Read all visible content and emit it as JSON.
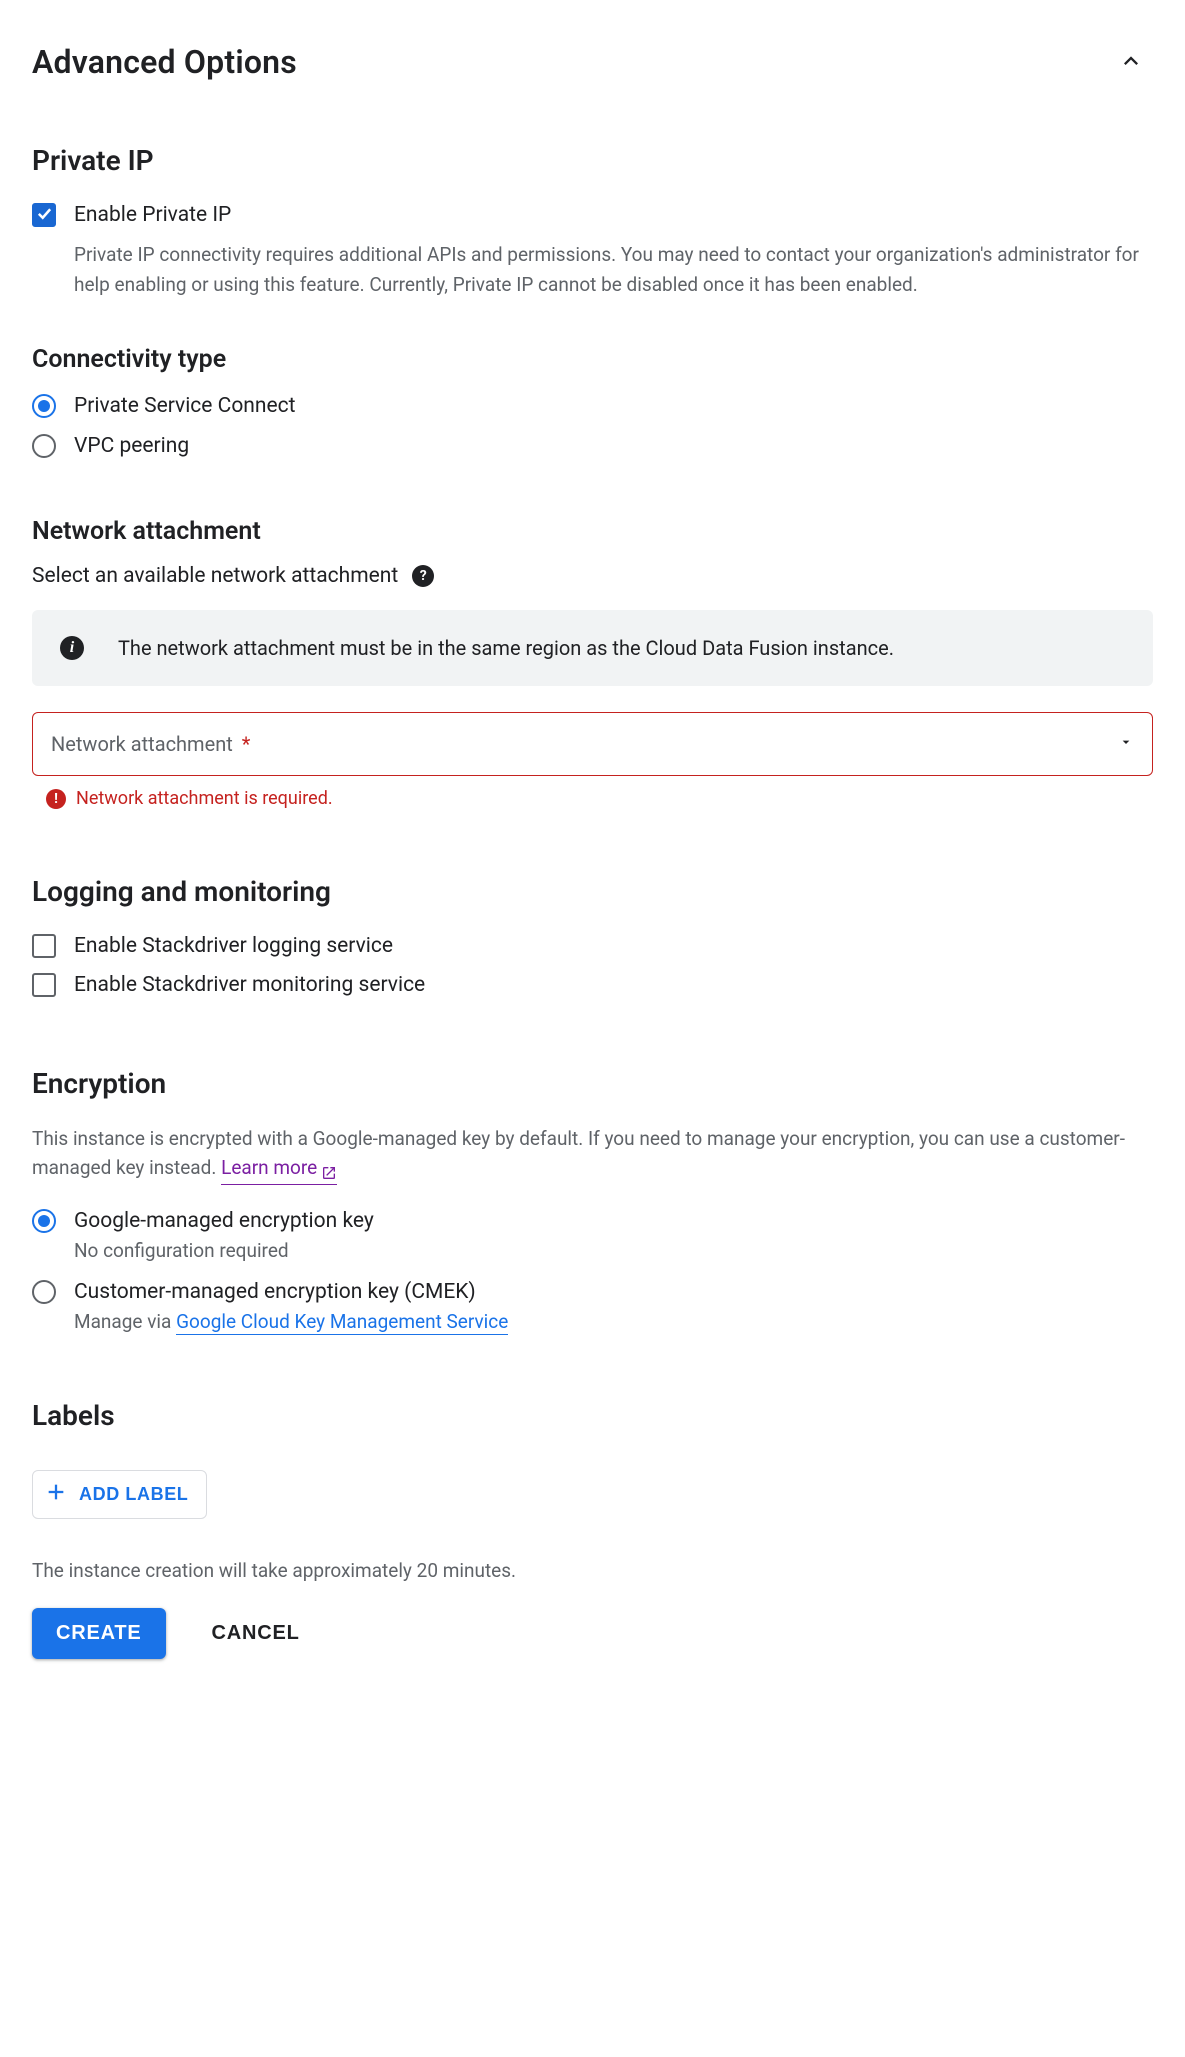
{
  "header": {
    "title": "Advanced Options"
  },
  "private_ip": {
    "heading": "Private IP",
    "checkbox_label": "Enable Private IP",
    "description": "Private IP connectivity requires additional APIs and permissions. You may need to contact your organization's administrator for help enabling or using this feature. Currently, Private IP cannot be disabled once it has been enabled."
  },
  "connectivity": {
    "heading": "Connectivity type",
    "options": [
      "Private Service Connect",
      "VPC peering"
    ]
  },
  "network_attachment": {
    "heading": "Network attachment",
    "prompt": "Select an available network attachment",
    "info": "The network attachment must be in the same region as the Cloud Data Fusion instance.",
    "select_label": "Network attachment",
    "required_mark": "*",
    "error": "Network attachment is required."
  },
  "logging": {
    "heading": "Logging and monitoring",
    "options": [
      "Enable Stackdriver logging service",
      "Enable Stackdriver monitoring service"
    ]
  },
  "encryption": {
    "heading": "Encryption",
    "description": "This instance is encrypted with a Google-managed key by default. If you need to manage your encryption, you can use a customer-managed key instead. ",
    "learn_more": "Learn more",
    "options": {
      "google": {
        "label": "Google-managed encryption key",
        "sub": "No configuration required"
      },
      "cmek": {
        "label": "Customer-managed encryption key (CMEK)",
        "sub_prefix": "Manage via ",
        "sub_link": "Google Cloud Key Management Service"
      }
    }
  },
  "labels": {
    "heading": "Labels",
    "add_button": "ADD LABEL"
  },
  "footer": {
    "note": "The instance creation will take approximately 20 minutes.",
    "create": "CREATE",
    "cancel": "CANCEL"
  }
}
